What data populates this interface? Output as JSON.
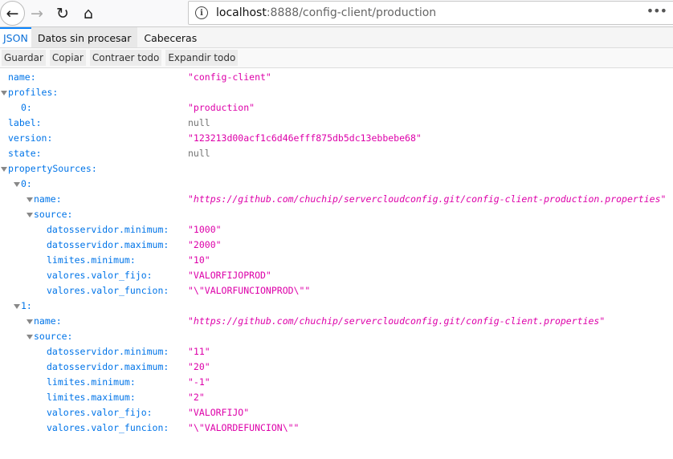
{
  "browser": {
    "url_host": "localhost",
    "url_path": ":8888/config-client/production",
    "menu_label": "•••"
  },
  "tabs": [
    "JSON",
    "Datos sin procesar",
    "Cabeceras"
  ],
  "toolbar": [
    "Guardar",
    "Copiar",
    "Contraer todo",
    "Expandir todo"
  ],
  "json": {
    "name": "config-client",
    "profiles": [
      "production"
    ],
    "label": null,
    "version": "123213d00acf1c6d46efff875db5dc13ebbebe68",
    "state": null,
    "propertySources": [
      {
        "name": "https://github.com/chuchip/servercloudconfig.git/config-client-production.properties",
        "source": {
          "datosservidor.minimum": "1000",
          "datosservidor.maximum": "2000",
          "limites.minimum": "10",
          "valores.valor_fijo": "VALORFIJOPROD",
          "valores.valor_funcion": "\\\"VALORFUNCIONPROD\\\""
        }
      },
      {
        "name": "https://github.com/chuchip/servercloudconfig.git/config-client.properties",
        "source": {
          "datosservidor.minimum": "11",
          "datosservidor.maximum": "20",
          "limites.minimum": "-1",
          "limites.maximum": "2",
          "valores.valor_fijo": "VALORFIJO",
          "valores.valor_funcion": "\\\"VALORDEFUNCION\\\""
        }
      }
    ]
  }
}
